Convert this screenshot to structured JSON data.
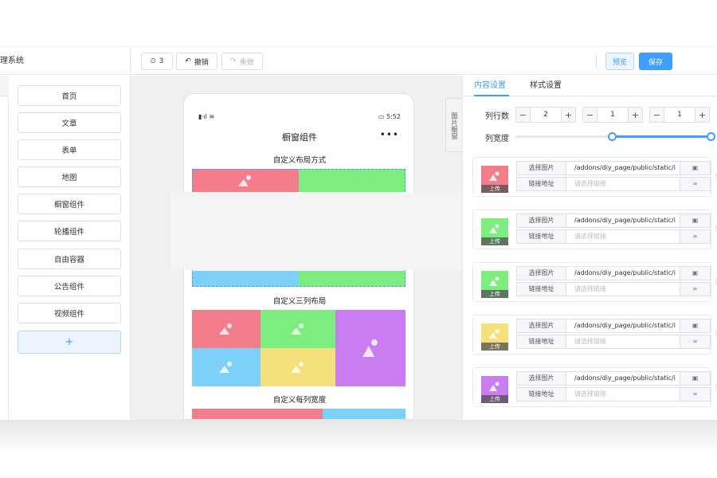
{
  "header": {
    "brand": "理系统",
    "history_label": "3",
    "undo_label": "撤销",
    "redo_label": "重做",
    "preview_label": "预览",
    "save_label": "保存"
  },
  "components": {
    "items": [
      "首页",
      "文章",
      "表单",
      "地图",
      "橱窗组件",
      "轮播组件",
      "自由容器",
      "公告组件",
      "视频组件"
    ],
    "add_label": "+"
  },
  "phone": {
    "status_left": "▮ᐧıl ≋",
    "status_right": "▭ 5:52",
    "title": "橱窗组件",
    "menu": "•••",
    "section1_title": "自定义布局方式",
    "section2_title": "自定义三列布局",
    "section3_title": "自定义每列宽度"
  },
  "side_tab": {
    "label": "图片橱窗"
  },
  "settings": {
    "tabs": [
      "内容设置",
      "样式设置"
    ],
    "active_tab": "内容设置",
    "columns_label": "列行数",
    "column_width_label": "列宽度",
    "steppers": [
      {
        "minus": "−",
        "value": "2",
        "plus": "+"
      },
      {
        "minus": "−",
        "value": "1",
        "plus": "+"
      },
      {
        "minus": "−",
        "value": "1",
        "plus": "+"
      }
    ],
    "slider_range": [
      0.5,
      1.0
    ],
    "items": [
      {
        "color": "#f47d8b",
        "upload": "上传",
        "image_label": "选择图片",
        "image_value": "/addons/diy_page/public/static/i",
        "link_label": "链接地址",
        "link_placeholder": "请选择链接"
      },
      {
        "color": "#7ded7f",
        "upload": "上传",
        "image_label": "选择图片",
        "image_value": "/addons/diy_page/public/static/i",
        "link_label": "链接地址",
        "link_placeholder": "请选择链接"
      },
      {
        "color": "#7ded7f",
        "upload": "上传",
        "image_label": "选择图片",
        "image_value": "/addons/diy_page/public/static/i",
        "link_label": "链接地址",
        "link_placeholder": "请选择链接"
      },
      {
        "color": "#f5e07c",
        "upload": "上传",
        "image_label": "选择图片",
        "image_value": "/addons/diy_page/public/static/i",
        "link_label": "链接地址",
        "link_placeholder": "请选择链接"
      },
      {
        "color": "#c97df0",
        "upload": "上传",
        "image_label": "选择图片",
        "image_value": "/addons/diy_page/public/static/i",
        "link_label": "链接地址",
        "link_placeholder": "请选择链接"
      }
    ]
  },
  "colors": {
    "accent": "#409eff",
    "pink": "#f47d8b",
    "green": "#7ded7f",
    "purple": "#c97df0",
    "blue": "#7dd0f7",
    "yellow": "#f5e07c"
  }
}
